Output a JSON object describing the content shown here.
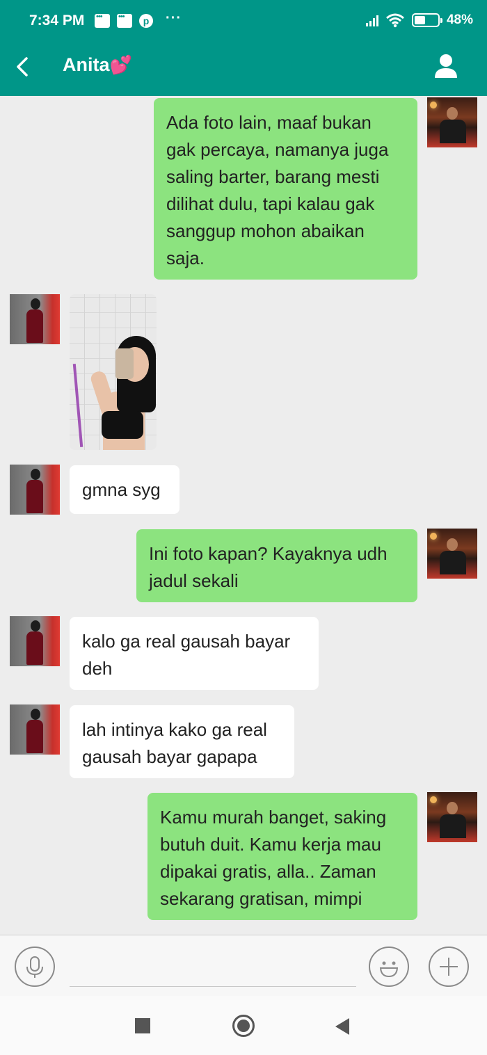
{
  "status_bar": {
    "time": "7:34 PM",
    "battery_percent": "48%",
    "battery_level": 0.48,
    "icons": [
      "message-icon",
      "message-icon",
      "pinterest-icon",
      "more-dots-icon",
      "signal-icon",
      "wifi-icon",
      "battery-icon"
    ]
  },
  "header": {
    "title": "Anita",
    "title_emoji": "💕",
    "back_icon": "chevron-left-icon",
    "profile_icon": "person-icon"
  },
  "messages": [
    {
      "sender": "me",
      "type": "text",
      "text": "Ada foto lain, maaf bukan gak percaya, namanya juga saling barter, barang mesti dilihat dulu, tapi kalau gak sanggup mohon abaikan saja."
    },
    {
      "sender": "Anita",
      "type": "image"
    },
    {
      "sender": "Anita",
      "type": "text",
      "text": "gmna syg"
    },
    {
      "sender": "me",
      "type": "text",
      "text": "Ini foto kapan? Kayaknya udh jadul sekali"
    },
    {
      "sender": "Anita",
      "type": "text",
      "text": "kalo ga real gausah bayar deh"
    },
    {
      "sender": "Anita",
      "type": "text",
      "text": "lah intinya kako ga real gausah bayar gapapa"
    },
    {
      "sender": "me",
      "type": "text",
      "text": "Kamu murah banget, saking butuh duit. Kamu kerja mau dipakai gratis, alla.. Zaman sekarang gratisan, mimpi"
    }
  ],
  "input_bar": {
    "value": "",
    "placeholder": "",
    "icons": [
      "microphone-icon",
      "emoji-icon",
      "plus-icon"
    ]
  },
  "colors": {
    "accent": "#009688",
    "outgoing_bubble": "#8ce37f",
    "incoming_bubble": "#ffffff",
    "background": "#ededed"
  }
}
